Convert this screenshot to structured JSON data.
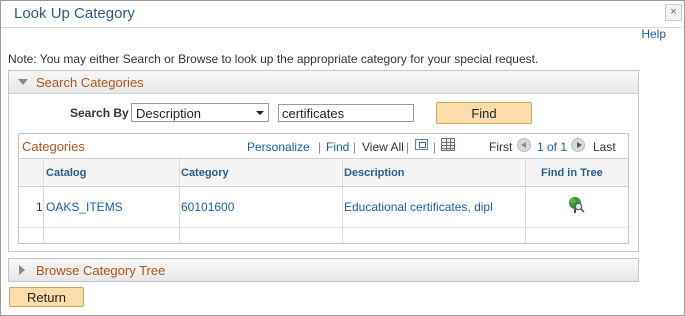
{
  "dialog": {
    "title": "Look Up Category",
    "close_glyph": "×",
    "help_label": "Help",
    "note": "Note: You may either Search or Browse to look up the appropriate category for your special request."
  },
  "search_panel": {
    "title": "Search Categories",
    "search_by_label": "Search By",
    "search_by_value": "Description",
    "search_text_value": "certificates",
    "find_button_label": "Find"
  },
  "grid": {
    "title": "Categories",
    "personalize_label": "Personalize",
    "find_label": "Find",
    "view_all_label": "View All",
    "separator": "|",
    "first_label": "First",
    "page_info": "1 of 1",
    "last_label": "Last",
    "columns": [
      "Catalog",
      "Category",
      "Description",
      "Find in Tree"
    ],
    "rows": [
      {
        "row_number": "1",
        "catalog": "OAKS_ITEMS",
        "category": "60101600",
        "description": "Educational certificates, dipl"
      }
    ]
  },
  "browse_panel": {
    "title": "Browse Category Tree"
  },
  "footer": {
    "return_button_label": "Return"
  },
  "colors": {
    "link": "#1b5fa6",
    "section_title": "#b0541a",
    "button_fill": "#fbdcab",
    "header_blue": "#2a5b8c"
  },
  "icons": {
    "zoom": "zoom-icon",
    "download": "excel-download-icon",
    "tree": "find-in-tree-icon"
  }
}
